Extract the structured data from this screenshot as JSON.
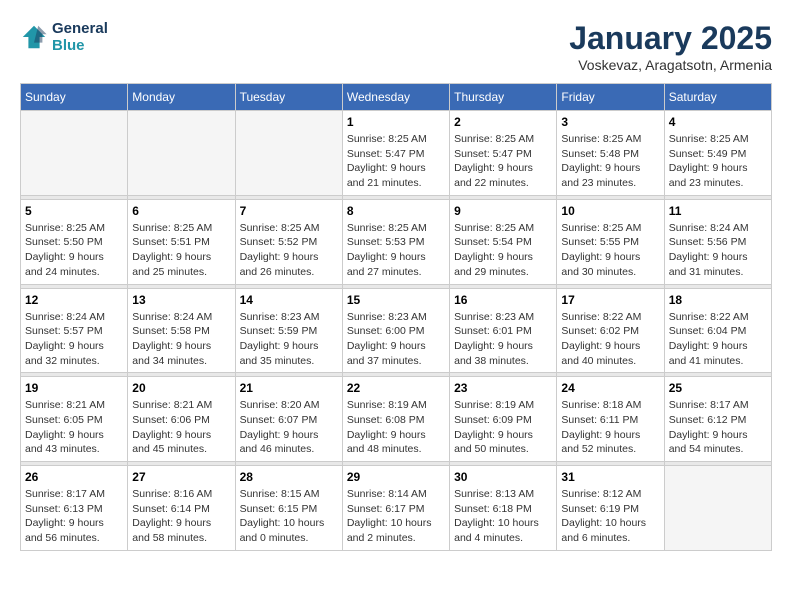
{
  "header": {
    "logo_line1": "General",
    "logo_line2": "Blue",
    "month_title": "January 2025",
    "location": "Voskevaz, Aragatsotn, Armenia"
  },
  "weekdays": [
    "Sunday",
    "Monday",
    "Tuesday",
    "Wednesday",
    "Thursday",
    "Friday",
    "Saturday"
  ],
  "weeks": [
    [
      {
        "day": "",
        "info": ""
      },
      {
        "day": "",
        "info": ""
      },
      {
        "day": "",
        "info": ""
      },
      {
        "day": "1",
        "info": "Sunrise: 8:25 AM\nSunset: 5:47 PM\nDaylight: 9 hours\nand 21 minutes."
      },
      {
        "day": "2",
        "info": "Sunrise: 8:25 AM\nSunset: 5:47 PM\nDaylight: 9 hours\nand 22 minutes."
      },
      {
        "day": "3",
        "info": "Sunrise: 8:25 AM\nSunset: 5:48 PM\nDaylight: 9 hours\nand 23 minutes."
      },
      {
        "day": "4",
        "info": "Sunrise: 8:25 AM\nSunset: 5:49 PM\nDaylight: 9 hours\nand 23 minutes."
      }
    ],
    [
      {
        "day": "5",
        "info": "Sunrise: 8:25 AM\nSunset: 5:50 PM\nDaylight: 9 hours\nand 24 minutes."
      },
      {
        "day": "6",
        "info": "Sunrise: 8:25 AM\nSunset: 5:51 PM\nDaylight: 9 hours\nand 25 minutes."
      },
      {
        "day": "7",
        "info": "Sunrise: 8:25 AM\nSunset: 5:52 PM\nDaylight: 9 hours\nand 26 minutes."
      },
      {
        "day": "8",
        "info": "Sunrise: 8:25 AM\nSunset: 5:53 PM\nDaylight: 9 hours\nand 27 minutes."
      },
      {
        "day": "9",
        "info": "Sunrise: 8:25 AM\nSunset: 5:54 PM\nDaylight: 9 hours\nand 29 minutes."
      },
      {
        "day": "10",
        "info": "Sunrise: 8:25 AM\nSunset: 5:55 PM\nDaylight: 9 hours\nand 30 minutes."
      },
      {
        "day": "11",
        "info": "Sunrise: 8:24 AM\nSunset: 5:56 PM\nDaylight: 9 hours\nand 31 minutes."
      }
    ],
    [
      {
        "day": "12",
        "info": "Sunrise: 8:24 AM\nSunset: 5:57 PM\nDaylight: 9 hours\nand 32 minutes."
      },
      {
        "day": "13",
        "info": "Sunrise: 8:24 AM\nSunset: 5:58 PM\nDaylight: 9 hours\nand 34 minutes."
      },
      {
        "day": "14",
        "info": "Sunrise: 8:23 AM\nSunset: 5:59 PM\nDaylight: 9 hours\nand 35 minutes."
      },
      {
        "day": "15",
        "info": "Sunrise: 8:23 AM\nSunset: 6:00 PM\nDaylight: 9 hours\nand 37 minutes."
      },
      {
        "day": "16",
        "info": "Sunrise: 8:23 AM\nSunset: 6:01 PM\nDaylight: 9 hours\nand 38 minutes."
      },
      {
        "day": "17",
        "info": "Sunrise: 8:22 AM\nSunset: 6:02 PM\nDaylight: 9 hours\nand 40 minutes."
      },
      {
        "day": "18",
        "info": "Sunrise: 8:22 AM\nSunset: 6:04 PM\nDaylight: 9 hours\nand 41 minutes."
      }
    ],
    [
      {
        "day": "19",
        "info": "Sunrise: 8:21 AM\nSunset: 6:05 PM\nDaylight: 9 hours\nand 43 minutes."
      },
      {
        "day": "20",
        "info": "Sunrise: 8:21 AM\nSunset: 6:06 PM\nDaylight: 9 hours\nand 45 minutes."
      },
      {
        "day": "21",
        "info": "Sunrise: 8:20 AM\nSunset: 6:07 PM\nDaylight: 9 hours\nand 46 minutes."
      },
      {
        "day": "22",
        "info": "Sunrise: 8:19 AM\nSunset: 6:08 PM\nDaylight: 9 hours\nand 48 minutes."
      },
      {
        "day": "23",
        "info": "Sunrise: 8:19 AM\nSunset: 6:09 PM\nDaylight: 9 hours\nand 50 minutes."
      },
      {
        "day": "24",
        "info": "Sunrise: 8:18 AM\nSunset: 6:11 PM\nDaylight: 9 hours\nand 52 minutes."
      },
      {
        "day": "25",
        "info": "Sunrise: 8:17 AM\nSunset: 6:12 PM\nDaylight: 9 hours\nand 54 minutes."
      }
    ],
    [
      {
        "day": "26",
        "info": "Sunrise: 8:17 AM\nSunset: 6:13 PM\nDaylight: 9 hours\nand 56 minutes."
      },
      {
        "day": "27",
        "info": "Sunrise: 8:16 AM\nSunset: 6:14 PM\nDaylight: 9 hours\nand 58 minutes."
      },
      {
        "day": "28",
        "info": "Sunrise: 8:15 AM\nSunset: 6:15 PM\nDaylight: 10 hours\nand 0 minutes."
      },
      {
        "day": "29",
        "info": "Sunrise: 8:14 AM\nSunset: 6:17 PM\nDaylight: 10 hours\nand 2 minutes."
      },
      {
        "day": "30",
        "info": "Sunrise: 8:13 AM\nSunset: 6:18 PM\nDaylight: 10 hours\nand 4 minutes."
      },
      {
        "day": "31",
        "info": "Sunrise: 8:12 AM\nSunset: 6:19 PM\nDaylight: 10 hours\nand 6 minutes."
      },
      {
        "day": "",
        "info": ""
      }
    ]
  ]
}
